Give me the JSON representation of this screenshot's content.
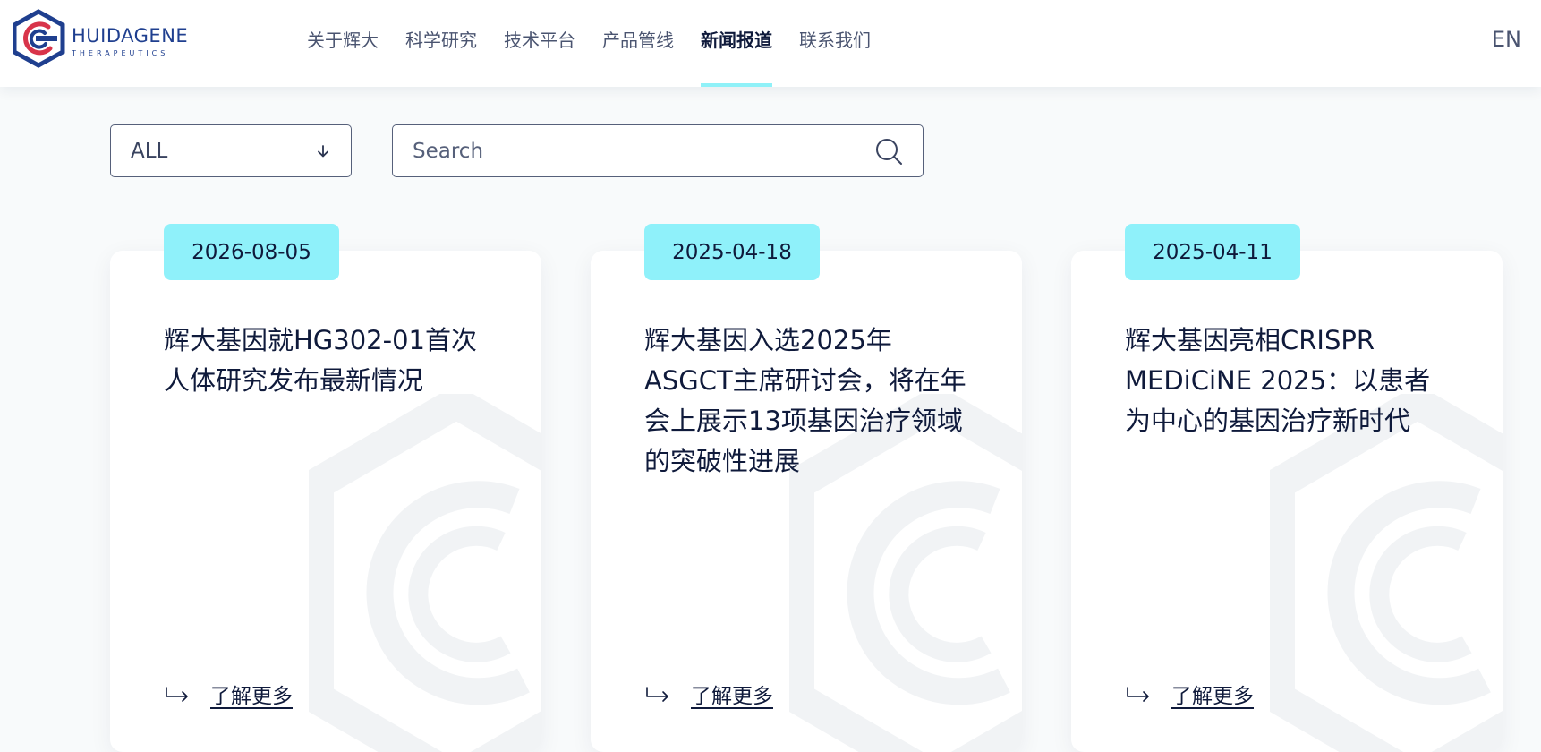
{
  "brand": {
    "name": "HUIDAGENE",
    "tagline": "THERAPEUTICS"
  },
  "nav": {
    "items": [
      {
        "label": "关于辉大"
      },
      {
        "label": "科学研究"
      },
      {
        "label": "技术平台"
      },
      {
        "label": "产品管线"
      },
      {
        "label": "新闻报道"
      },
      {
        "label": "联系我们"
      }
    ],
    "active_index": 4,
    "lang_label": "EN"
  },
  "filter": {
    "category_value": "ALL",
    "search_placeholder": "Search"
  },
  "news": [
    {
      "date": "2026-08-05",
      "title": "辉大基因就HG302-01首次人体研究发布最新情况",
      "more_label": "了解更多"
    },
    {
      "date": "2025-04-18",
      "title": "辉大基因入选2025年ASGCT主席研讨会，将在年会上展示13项基因治疗领域的突破性进展",
      "more_label": "了解更多"
    },
    {
      "date": "2025-04-11",
      "title": "辉大基因亮相CRISPR MEDiCiNE 2025：以患者为中心的基因治疗新时代",
      "more_label": "了解更多"
    }
  ],
  "colors": {
    "accent": "#8ff1fa",
    "text_dark": "#0f1a3b",
    "brand_blue": "#1f3f8f",
    "brand_red": "#d8344a"
  },
  "icons": {
    "logo": "hexagon-g-logo-icon",
    "dropdown": "chevron-down-icon",
    "search": "search-icon",
    "more": "return-arrow-icon"
  }
}
